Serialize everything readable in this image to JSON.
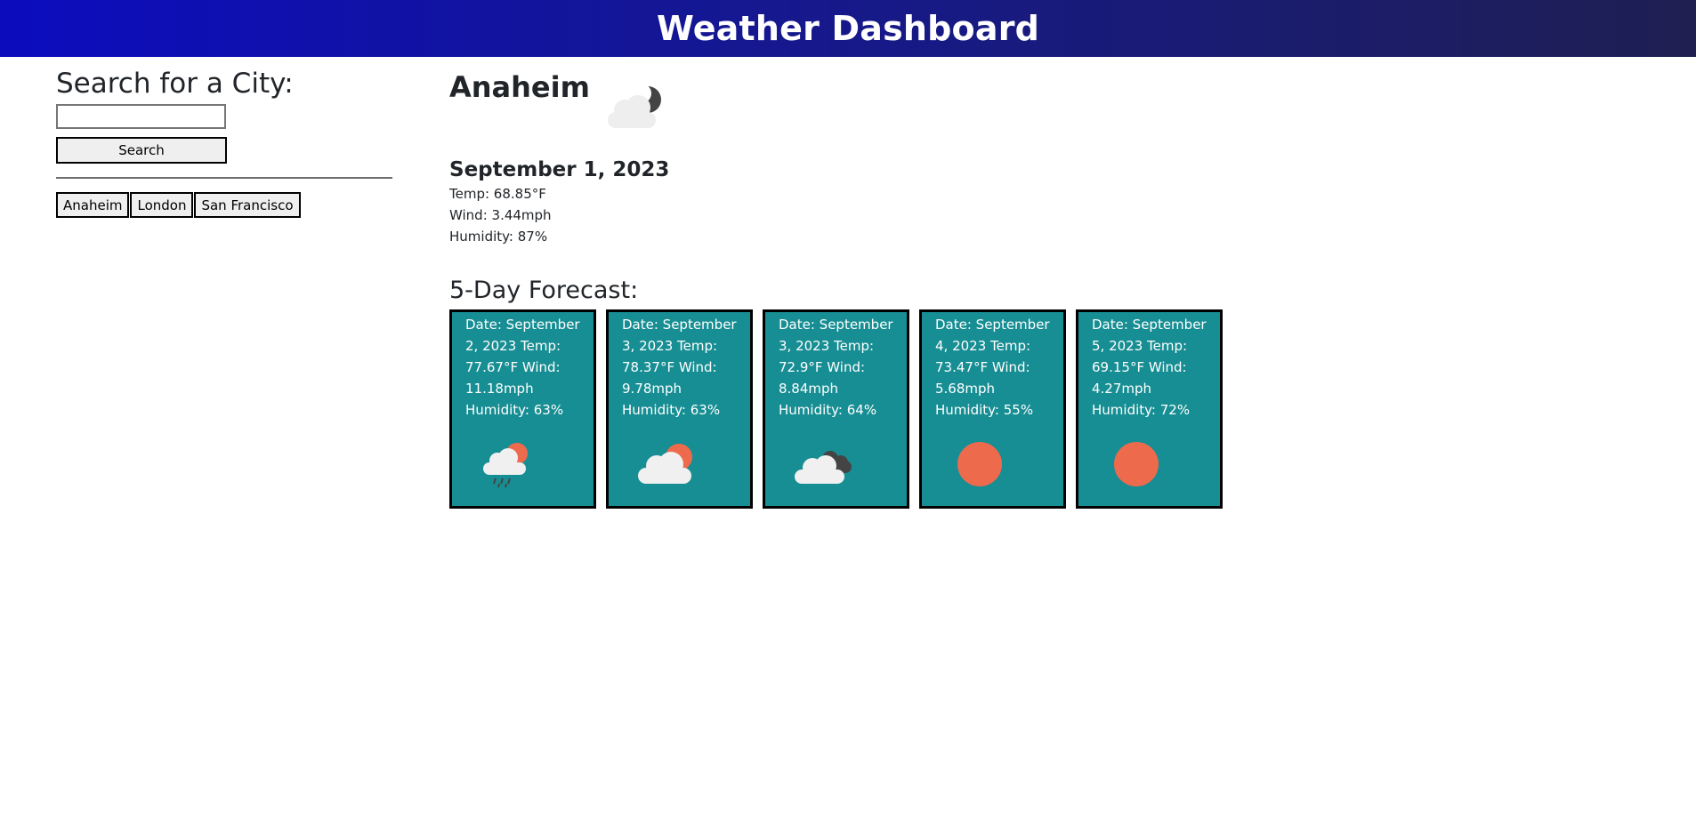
{
  "header": {
    "title": "Weather Dashboard"
  },
  "sidebar": {
    "heading": "Search for a City:",
    "search_value": "",
    "search_button": "Search",
    "history": [
      "Anaheim",
      "London",
      "San Francisco"
    ]
  },
  "current": {
    "city": "Anaheim",
    "icon": "cloudy-night-icon",
    "date": "September 1, 2023",
    "temp": "Temp: 68.85°F",
    "wind": "Wind: 3.44mph",
    "humidity": "Humidity: 87%"
  },
  "forecast": {
    "title": "5-Day Forecast:",
    "days": [
      {
        "text": "Date: September 2, 2023 Temp: 77.67°F Wind: 11.18mph Humidity: 63%",
        "icon": "rain-sun-icon"
      },
      {
        "text": "Date: September 3, 2023 Temp: 78.37°F Wind: 9.78mph Humidity: 63%",
        "icon": "partly-cloudy-icon"
      },
      {
        "text": "Date: September 3, 2023 Temp: 72.9°F Wind: 8.84mph Humidity: 64%",
        "icon": "cloudy-icon"
      },
      {
        "text": "Date: September 4, 2023 Temp: 73.47°F Wind: 5.68mph Humidity: 55%",
        "icon": "sun-icon"
      },
      {
        "text": "Date: September 5, 2023 Temp: 69.15°F Wind: 4.27mph Humidity: 72%",
        "icon": "sun-icon"
      }
    ]
  },
  "colors": {
    "card": "#178e93",
    "sun": "#ee6a4d",
    "cloud": "#f0f0f0",
    "dark_cloud": "#444444"
  }
}
